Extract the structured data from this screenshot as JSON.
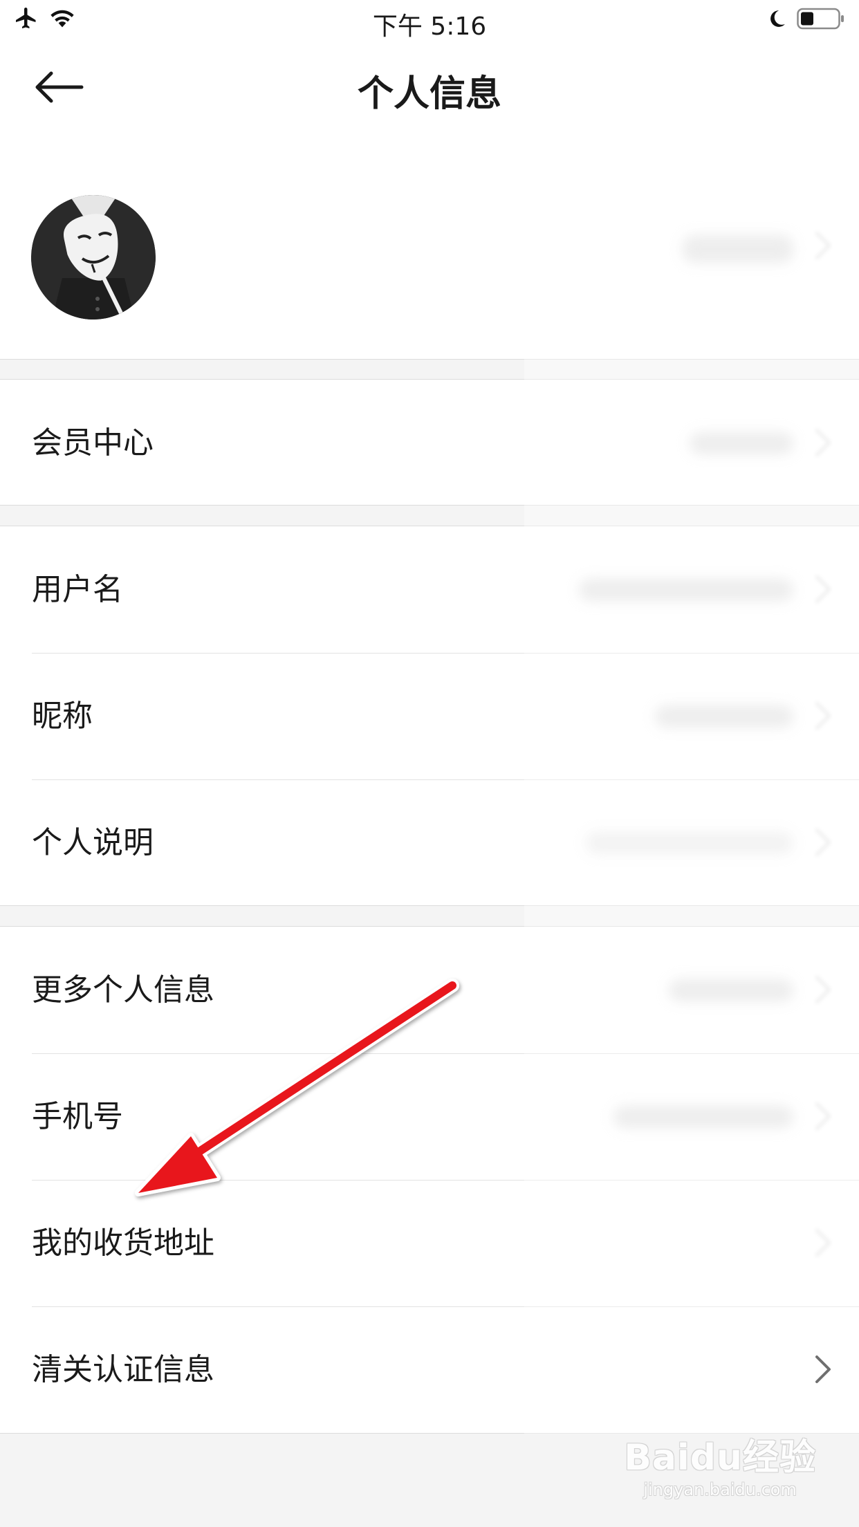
{
  "status_bar": {
    "time": "下午 5:16",
    "icons": [
      "airplane-icon",
      "wifi-icon",
      "moon-icon",
      "battery-icon"
    ]
  },
  "nav": {
    "title": "个人信息",
    "back_icon": "arrow-left-icon"
  },
  "avatar_row": {
    "avatar": "avatar-image"
  },
  "sections": {
    "vip": [
      {
        "label": "会员中心"
      }
    ],
    "profile": [
      {
        "label": "用户名"
      },
      {
        "label": "昵称"
      },
      {
        "label": "个人说明"
      }
    ],
    "more": [
      {
        "label": "更多个人信息"
      },
      {
        "label": "手机号"
      },
      {
        "label": "我的收货地址"
      },
      {
        "label": "清关认证信息"
      }
    ]
  },
  "annotation": {
    "type": "arrow",
    "color": "#e8141c",
    "points_to": "我的收货地址"
  },
  "watermark": {
    "logo": "Baidu经验",
    "url": "jingyan.baidu.com"
  },
  "colors": {
    "background": "#f4f4f4",
    "surface": "#ffffff",
    "divider": "#dcdcdc",
    "text": "#1a1a1a",
    "arrow": "#e8141c"
  }
}
